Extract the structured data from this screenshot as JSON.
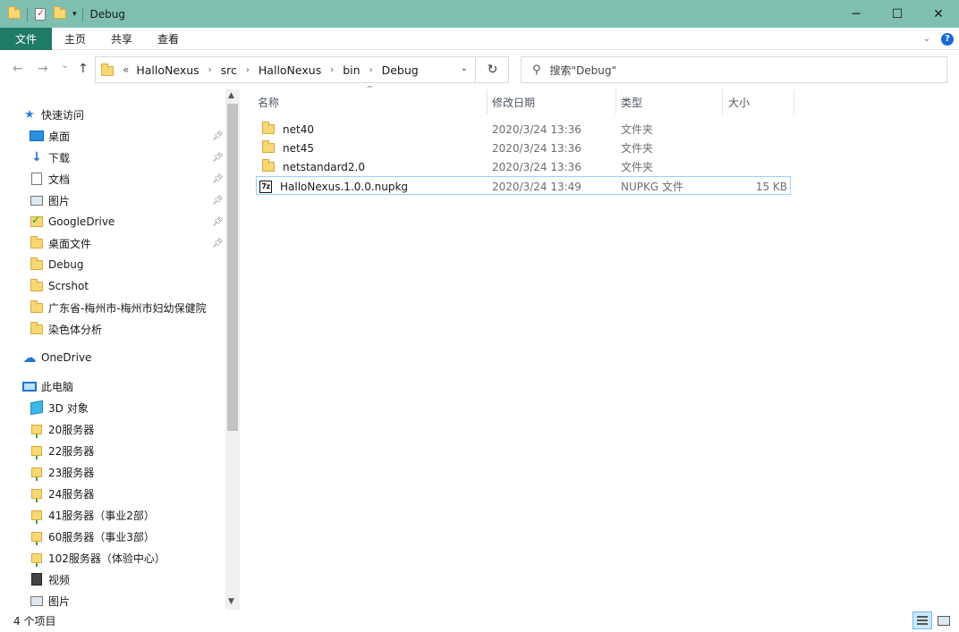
{
  "window": {
    "title": "Debug",
    "controls": {
      "minimize": "─",
      "maximize": "☐",
      "close": "✕"
    }
  },
  "ribbon": {
    "tabs": [
      "文件",
      "主页",
      "共享",
      "查看"
    ],
    "collapse_icon": "chevron-down",
    "help_label": "?"
  },
  "nav": {
    "back": "←",
    "forward": "→",
    "recent": "⌄",
    "up": "↑",
    "address_lead": "«",
    "breadcrumb": [
      "HalloNexus",
      "src",
      "HalloNexus",
      "bin",
      "Debug"
    ],
    "refresh": "↻",
    "search_placeholder": "搜索\"Debug\""
  },
  "sidebar": {
    "items": [
      {
        "label": "快速访问",
        "icon": "star-icon",
        "pinned": false,
        "level": 0
      },
      {
        "label": "桌面",
        "icon": "desktop-icon",
        "pinned": true,
        "level": 1
      },
      {
        "label": "下载",
        "icon": "download-icon",
        "pinned": true,
        "level": 1
      },
      {
        "label": "文档",
        "icon": "document-icon",
        "pinned": true,
        "level": 1
      },
      {
        "label": "图片",
        "icon": "pictures-icon",
        "pinned": true,
        "level": 1
      },
      {
        "label": "GoogleDrive",
        "icon": "googledrive-folder-icon",
        "pinned": true,
        "level": 1
      },
      {
        "label": "桌面文件",
        "icon": "folder-icon",
        "pinned": true,
        "level": 1
      },
      {
        "label": "Debug",
        "icon": "folder-icon",
        "pinned": false,
        "level": 1
      },
      {
        "label": "Scrshot",
        "icon": "folder-icon",
        "pinned": false,
        "level": 1
      },
      {
        "label": "广东省-梅州市-梅州市妇幼保健院",
        "icon": "folder-icon",
        "pinned": false,
        "level": 1
      },
      {
        "label": "染色体分析",
        "icon": "folder-icon",
        "pinned": false,
        "level": 1
      },
      {
        "label": "OneDrive",
        "icon": "cloud-icon",
        "pinned": false,
        "level": 0
      },
      {
        "label": "此电脑",
        "icon": "computer-icon",
        "pinned": false,
        "level": 0
      },
      {
        "label": "3D 对象",
        "icon": "cube-icon",
        "pinned": false,
        "level": 1
      },
      {
        "label": "20服务器",
        "icon": "network-drive-icon",
        "pinned": false,
        "level": 1
      },
      {
        "label": "22服务器",
        "icon": "network-drive-icon",
        "pinned": false,
        "level": 1
      },
      {
        "label": "23服务器",
        "icon": "network-drive-icon",
        "pinned": false,
        "level": 1
      },
      {
        "label": "24服务器",
        "icon": "network-drive-icon",
        "pinned": false,
        "level": 1
      },
      {
        "label": "41服务器（事业2部）",
        "icon": "network-drive-icon",
        "pinned": false,
        "level": 1
      },
      {
        "label": "60服务器（事业3部）",
        "icon": "network-drive-icon",
        "pinned": false,
        "level": 1
      },
      {
        "label": "102服务器（体验中心）",
        "icon": "network-drive-icon",
        "pinned": false,
        "level": 1
      },
      {
        "label": "视频",
        "icon": "video-icon",
        "pinned": false,
        "level": 1
      },
      {
        "label": "图片",
        "icon": "pictures-icon",
        "pinned": false,
        "level": 1
      }
    ]
  },
  "files": {
    "columns": {
      "name": "名称",
      "date": "修改日期",
      "type": "类型",
      "size": "大小"
    },
    "rows": [
      {
        "name": "net40",
        "date": "2020/3/24 13:36",
        "type": "文件夹",
        "size": "",
        "icon": "folder-icon",
        "selected": false
      },
      {
        "name": "net45",
        "date": "2020/3/24 13:36",
        "type": "文件夹",
        "size": "",
        "icon": "folder-icon",
        "selected": false
      },
      {
        "name": "netstandard2.0",
        "date": "2020/3/24 13:36",
        "type": "文件夹",
        "size": "",
        "icon": "folder-icon",
        "selected": false
      },
      {
        "name": "HalloNexus.1.0.0.nupkg",
        "date": "2020/3/24 13:49",
        "type": "NUPKG 文件",
        "size": "15 KB",
        "icon": "7zip-file-icon",
        "selected": true
      }
    ]
  },
  "status": {
    "count": "4 个项目"
  },
  "colors": {
    "titlebar": "#7fbfb0",
    "file_tab": "#1f7a66",
    "selection_border": "#99d1ff"
  }
}
